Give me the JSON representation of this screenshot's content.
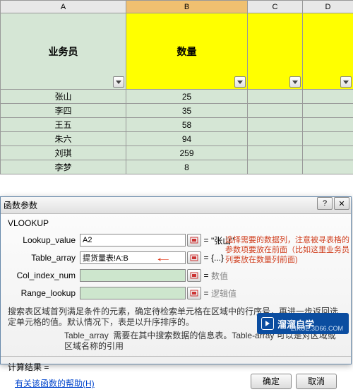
{
  "columns": {
    "A": "A",
    "B": "B",
    "C": "C",
    "D": "D"
  },
  "headers": {
    "A": "业务员",
    "B": "数量"
  },
  "rows": [
    {
      "name": "张山",
      "qty": "25"
    },
    {
      "name": "李四",
      "qty": "35"
    },
    {
      "name": "王五",
      "qty": "58"
    },
    {
      "name": "朱六",
      "qty": "94"
    },
    {
      "name": "刘琪",
      "qty": "259"
    },
    {
      "name": "李梦",
      "qty": "8"
    }
  ],
  "dialog": {
    "title": "函数参数",
    "func": "VLOOKUP",
    "fields": {
      "lookup_value": {
        "label": "Lookup_value",
        "value": "A2",
        "result": "\"张山\""
      },
      "table_array": {
        "label": "Table_array",
        "value": "提货量表!A:B",
        "result": "{...}"
      },
      "col_index_num": {
        "label": "Col_index_num",
        "value": "",
        "result": "数值"
      },
      "range_lookup": {
        "label": "Range_lookup",
        "value": "",
        "result": "逻辑值"
      }
    },
    "annotation": "选择需要的数据列，注意被寻表格的参数项要放在前面（比如这里业务员列要放在数量列前面)",
    "desc1": "搜索表区域首列满足条件的元素，确定待检索单元格在区域中的行序号，再进一步返回选定单元格的值。默认情况下，表是以升序排序的。",
    "desc2_label": "Table_array",
    "desc2_text": "需要在其中搜索数据的信息表。Table-array 可以是对区域或区域名称的引用",
    "calc_result_label": "计算结果 =",
    "help_link": "有关该函数的帮助(H)",
    "ok": "确定",
    "cancel": "取消"
  },
  "logo": {
    "brand": "溜溜自学",
    "url": "ZIXUE.3D66.COM"
  }
}
